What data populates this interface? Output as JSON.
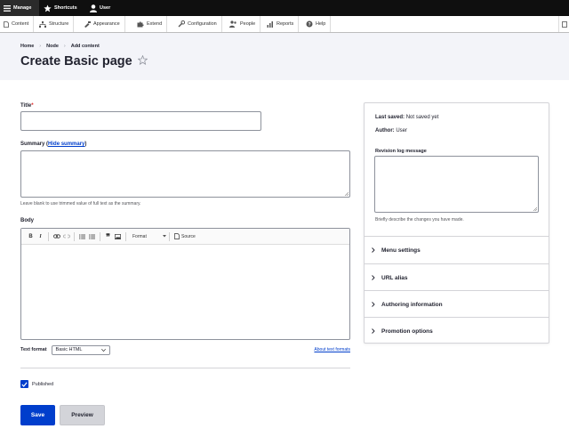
{
  "toolbar": {
    "manage": "Manage",
    "shortcuts": "Shortcuts",
    "user": "User"
  },
  "admin_menu": [
    "Content",
    "Structure",
    "Appearance",
    "Extend",
    "Configuration",
    "People",
    "Reports",
    "Help"
  ],
  "breadcrumb": [
    "Home",
    "Node",
    "Add content"
  ],
  "page_title": "Create Basic page",
  "form": {
    "title_label": "Title",
    "required_mark": "*",
    "title_value": "",
    "summary_label": "Summary",
    "summary_toggle": "Hide summary",
    "summary_help": "Leave blank to use trimmed value of full text as the summary.",
    "body_label": "Body",
    "editor_format_label": "Format",
    "editor_source_label": "Source",
    "text_format_label": "Text format",
    "text_format_value": "Basic HTML",
    "about_text_formats": "About text formats",
    "published_label": "Published",
    "published_checked": true,
    "save_label": "Save",
    "preview_label": "Preview"
  },
  "sidebar": {
    "last_saved_label": "Last saved:",
    "last_saved_value": "Not saved yet",
    "author_label": "Author:",
    "author_value": "User",
    "revision_label": "Revision log message",
    "revision_help": "Briefly describe the changes you have made.",
    "sections": [
      "Menu settings",
      "URL alias",
      "Authoring information",
      "Promotion options"
    ]
  },
  "colors": {
    "primary": "#003ecc",
    "toolbar_bg": "#0f0f0f",
    "header_bg": "#f3f4f9",
    "required": "#dc2323"
  }
}
